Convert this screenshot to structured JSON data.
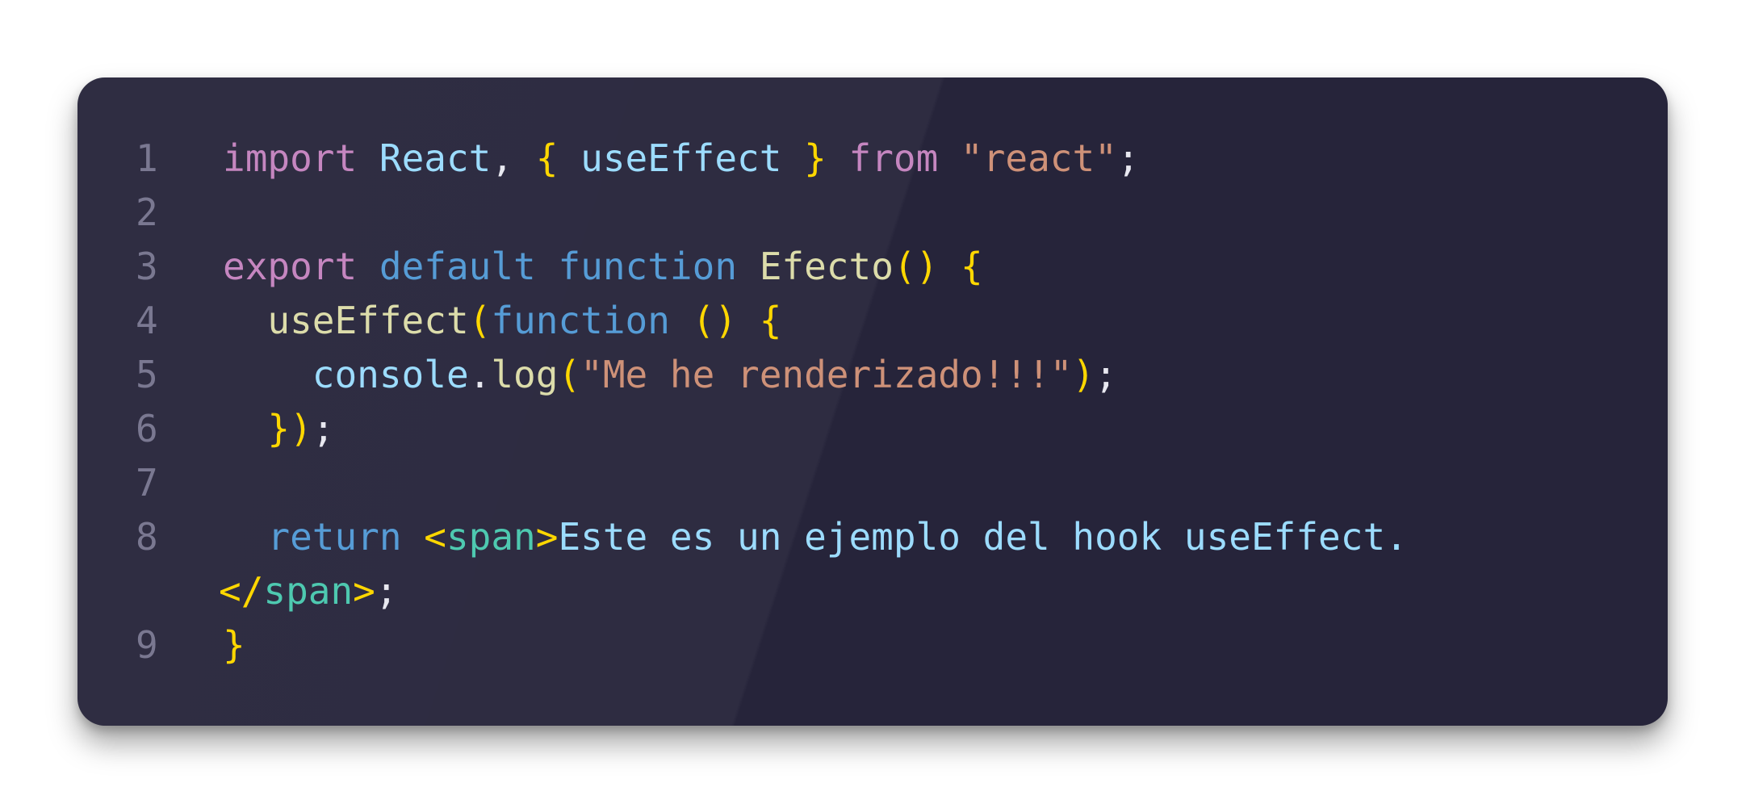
{
  "editor": {
    "colors": {
      "background": "#26243a",
      "line_number": "#7a7891",
      "keyword": "#c586c0",
      "storage": "#569cd6",
      "identifier": "#9cdcfe",
      "function": "#dcdcaa",
      "string": "#ce9178",
      "bracket": "#ffd700",
      "tag": "#4ec9b0",
      "punctuation": "#e8e8f0"
    },
    "lines": [
      {
        "number": "1",
        "tokens": [
          {
            "text": "import",
            "kind": "keyword"
          },
          {
            "text": " ",
            "kind": "punctuation"
          },
          {
            "text": "React",
            "kind": "identifier"
          },
          {
            "text": ", ",
            "kind": "punctuation"
          },
          {
            "text": "{",
            "kind": "bracket"
          },
          {
            "text": " ",
            "kind": "punctuation"
          },
          {
            "text": "useEffect",
            "kind": "identifier"
          },
          {
            "text": " ",
            "kind": "punctuation"
          },
          {
            "text": "}",
            "kind": "bracket"
          },
          {
            "text": " ",
            "kind": "punctuation"
          },
          {
            "text": "from",
            "kind": "keyword"
          },
          {
            "text": " ",
            "kind": "punctuation"
          },
          {
            "text": "\"react\"",
            "kind": "string"
          },
          {
            "text": ";",
            "kind": "punctuation"
          }
        ]
      },
      {
        "number": "2",
        "tokens": []
      },
      {
        "number": "3",
        "tokens": [
          {
            "text": "export",
            "kind": "keyword"
          },
          {
            "text": " ",
            "kind": "punctuation"
          },
          {
            "text": "default",
            "kind": "storage"
          },
          {
            "text": " ",
            "kind": "punctuation"
          },
          {
            "text": "function",
            "kind": "storage"
          },
          {
            "text": " ",
            "kind": "punctuation"
          },
          {
            "text": "Efecto",
            "kind": "function"
          },
          {
            "text": "()",
            "kind": "bracket"
          },
          {
            "text": " ",
            "kind": "punctuation"
          },
          {
            "text": "{",
            "kind": "bracket"
          }
        ]
      },
      {
        "number": "4",
        "tokens": [
          {
            "text": "  ",
            "kind": "punctuation"
          },
          {
            "text": "useEffect",
            "kind": "function"
          },
          {
            "text": "(",
            "kind": "bracket"
          },
          {
            "text": "function",
            "kind": "storage"
          },
          {
            "text": " ",
            "kind": "punctuation"
          },
          {
            "text": "()",
            "kind": "bracket"
          },
          {
            "text": " ",
            "kind": "punctuation"
          },
          {
            "text": "{",
            "kind": "bracket"
          }
        ]
      },
      {
        "number": "5",
        "tokens": [
          {
            "text": "    ",
            "kind": "punctuation"
          },
          {
            "text": "console",
            "kind": "identifier"
          },
          {
            "text": ".",
            "kind": "punctuation"
          },
          {
            "text": "log",
            "kind": "function"
          },
          {
            "text": "(",
            "kind": "bracket"
          },
          {
            "text": "\"Me he renderizado!!!\"",
            "kind": "string"
          },
          {
            "text": ")",
            "kind": "bracket"
          },
          {
            "text": ";",
            "kind": "punctuation"
          }
        ]
      },
      {
        "number": "6",
        "tokens": [
          {
            "text": "  ",
            "kind": "punctuation"
          },
          {
            "text": "})",
            "kind": "bracket"
          },
          {
            "text": ";",
            "kind": "punctuation"
          }
        ]
      },
      {
        "number": "7",
        "tokens": []
      },
      {
        "number": "8",
        "tokens": [
          {
            "text": "  ",
            "kind": "punctuation"
          },
          {
            "text": "return",
            "kind": "storage"
          },
          {
            "text": " ",
            "kind": "punctuation"
          },
          {
            "text": "<",
            "kind": "bracket"
          },
          {
            "text": "span",
            "kind": "tag"
          },
          {
            "text": ">",
            "kind": "bracket"
          },
          {
            "text": "Este es un ejemplo del hook useEffect.",
            "kind": "identifier"
          }
        ]
      },
      {
        "number": "",
        "tokens": [
          {
            "text": "</",
            "kind": "bracket"
          },
          {
            "text": "span",
            "kind": "tag"
          },
          {
            "text": ">",
            "kind": "bracket"
          },
          {
            "text": ";",
            "kind": "punctuation"
          }
        ]
      },
      {
        "number": "9",
        "tokens": [
          {
            "text": "}",
            "kind": "bracket"
          }
        ]
      }
    ]
  }
}
